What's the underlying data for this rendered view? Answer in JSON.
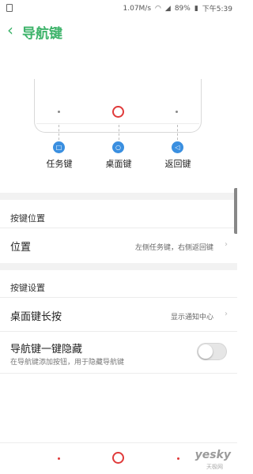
{
  "status_bar": {
    "speed": "1.07M/s",
    "battery": "89%",
    "time": "下午5:39",
    "icons": [
      "wifi-icon",
      "signal-icon",
      "battery-icon"
    ]
  },
  "header": {
    "back_icon": "chevron-left-icon",
    "title": "导航键"
  },
  "illustration": {
    "keys": [
      {
        "icon": "square-icon",
        "label": "任务键"
      },
      {
        "icon": "circle-icon",
        "label": "桌面键"
      },
      {
        "icon": "triangle-left-icon",
        "label": "返回键"
      }
    ]
  },
  "sections": {
    "key_position": {
      "title": "按键位置",
      "rows": [
        {
          "label": "位置",
          "value": "左侧任务键，右侧返回键"
        }
      ]
    },
    "key_settings": {
      "title": "按键设置",
      "rows": [
        {
          "label": "桌面键长按",
          "value": "显示通知中心"
        },
        {
          "label": "导航键一键隐藏",
          "subtitle": "在导航键添加按钮，用于隐藏导航键",
          "toggle": false
        }
      ]
    }
  },
  "watermark": {
    "text": "yesky",
    "sub": "天极网"
  },
  "colors": {
    "accent": "#3db36a",
    "home_red": "#e03a3a",
    "key_blue": "#3a8fe0"
  }
}
